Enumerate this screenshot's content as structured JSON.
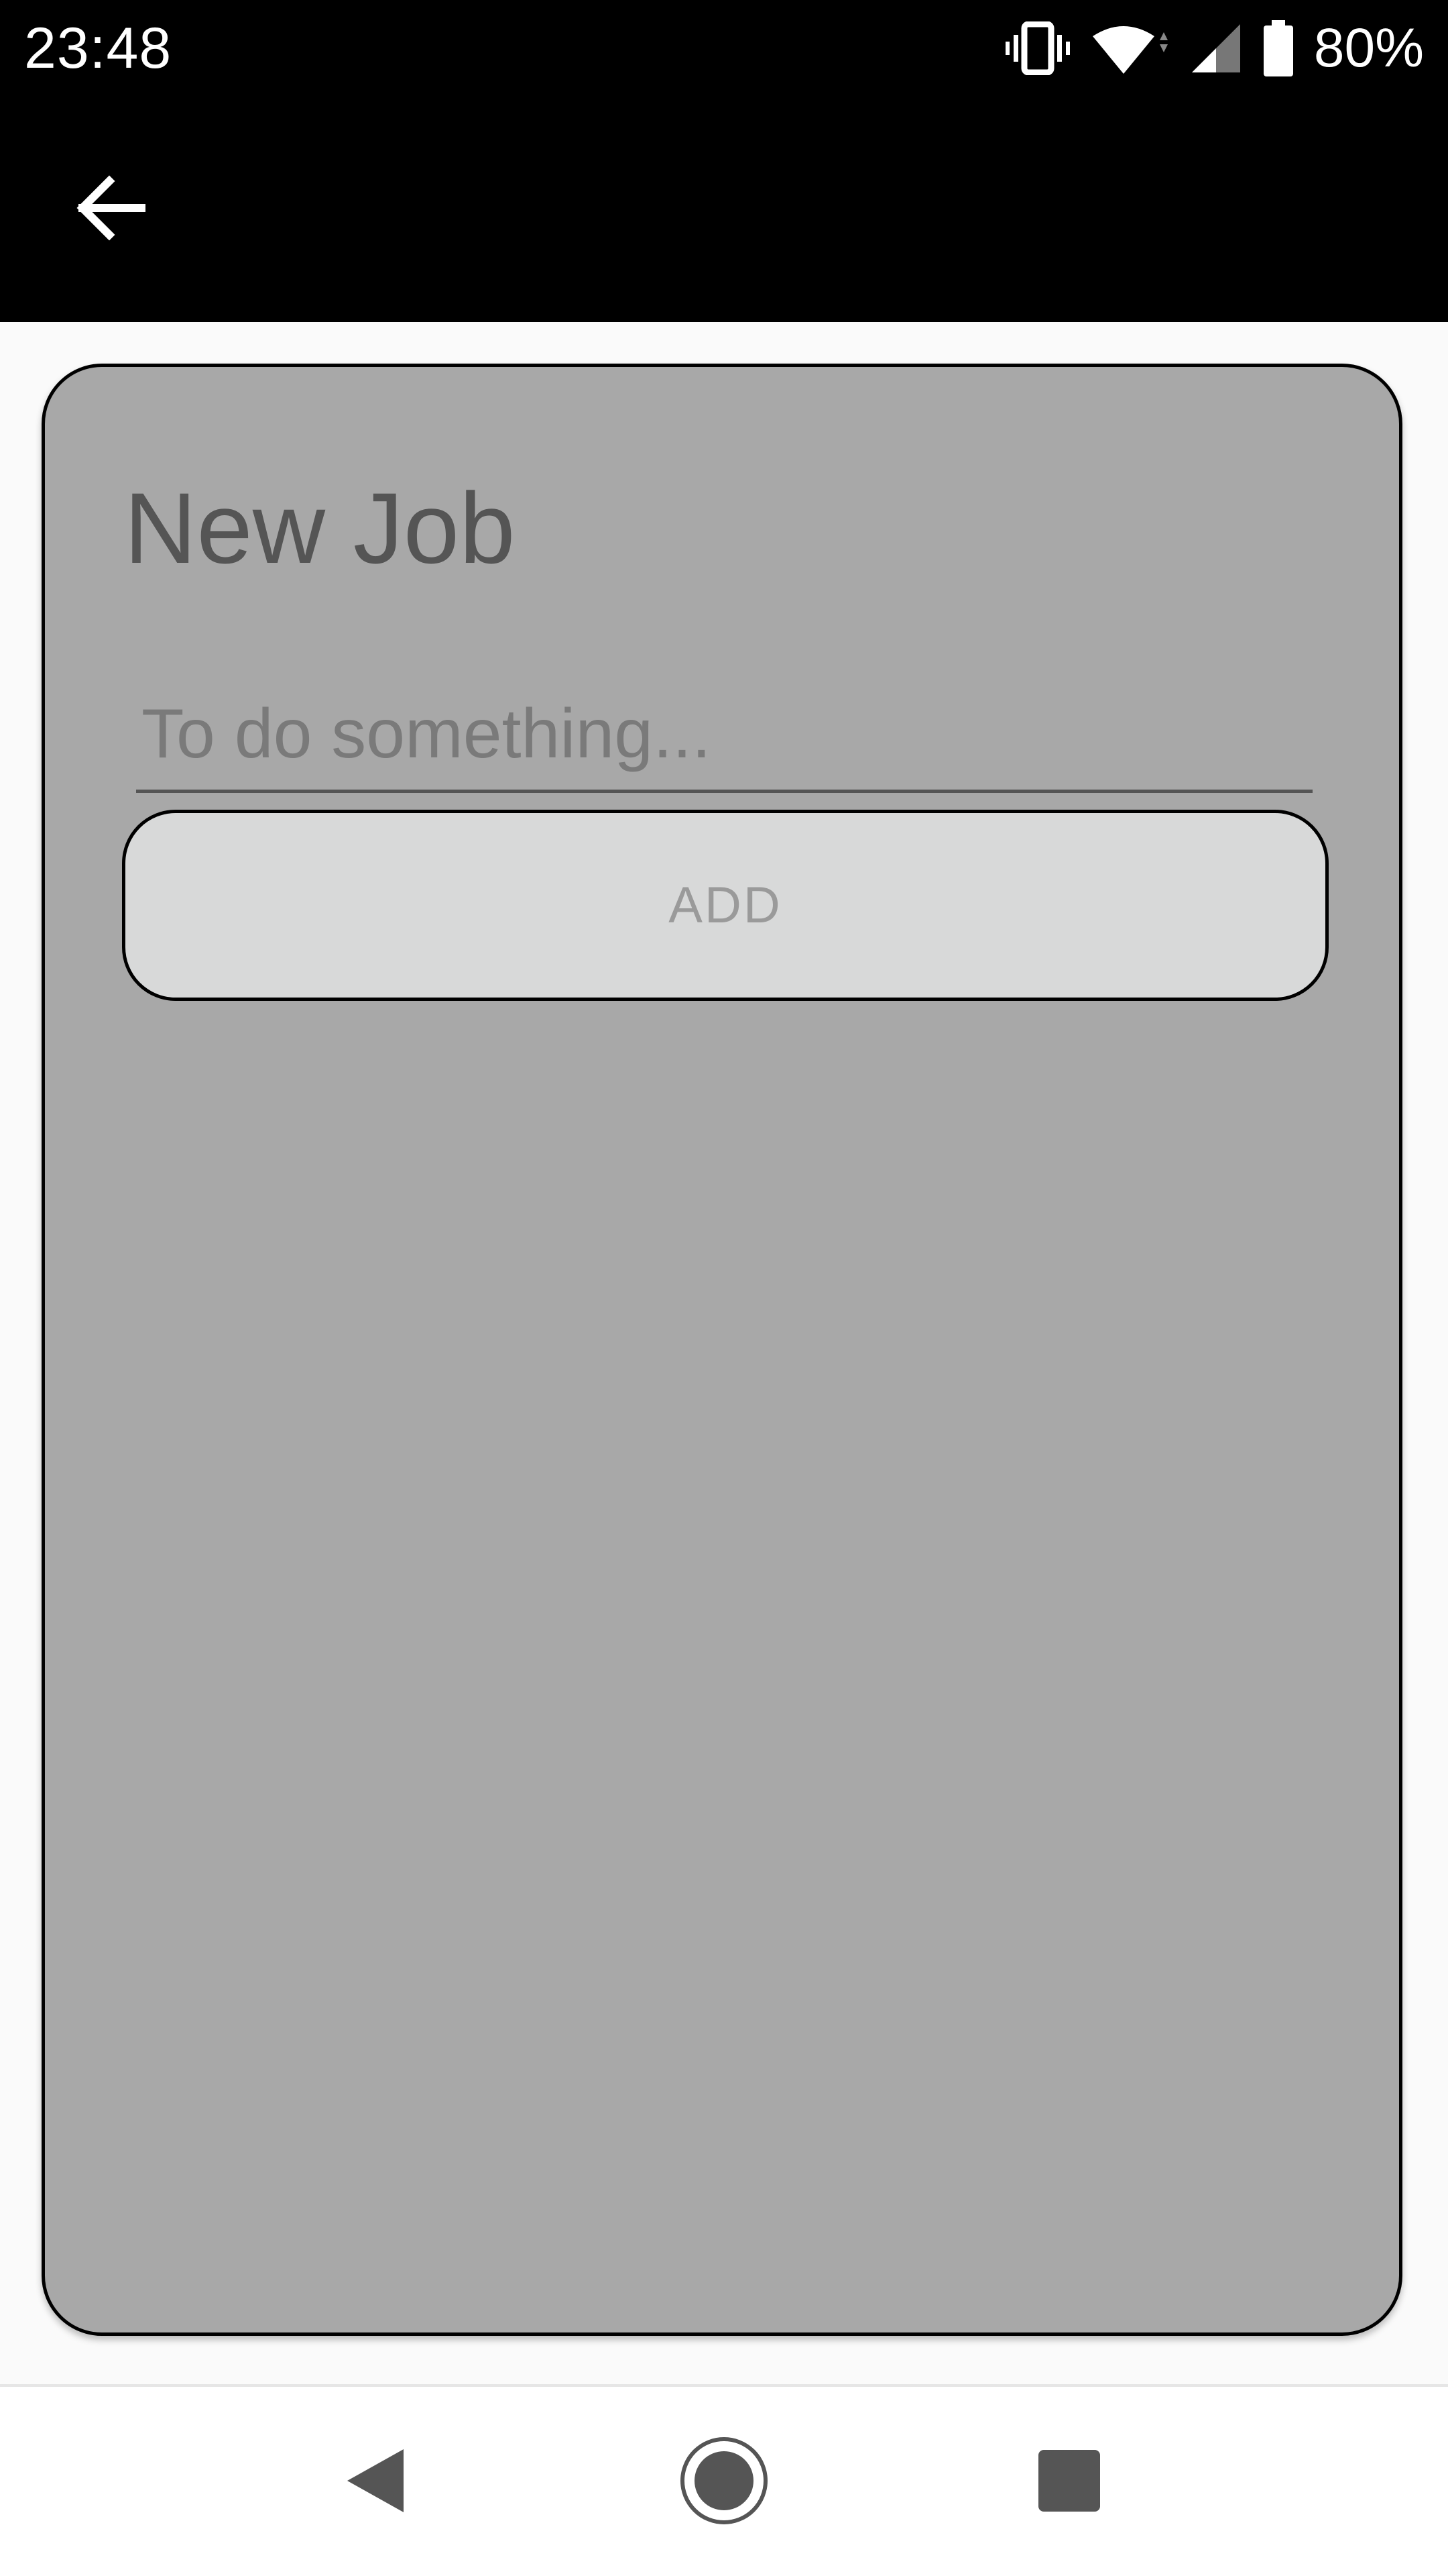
{
  "status_bar": {
    "time": "23:48",
    "battery_percent": "80%",
    "icons": [
      "vibrate-icon",
      "wifi-icon",
      "signal-icon",
      "battery-icon"
    ]
  },
  "app_bar": {
    "back_icon": "arrow-left-icon"
  },
  "card": {
    "title": "New Job",
    "input_placeholder": "To do something...",
    "input_value": "",
    "add_label": "ADD"
  },
  "nav_bar": {
    "icons": [
      "nav-back-icon",
      "nav-home-icon",
      "nav-recents-icon"
    ]
  },
  "colors": {
    "card_background": "#a8a8a8",
    "button_background": "#d8d9d9",
    "bar_background": "#000000",
    "page_background": "#fafafa"
  }
}
